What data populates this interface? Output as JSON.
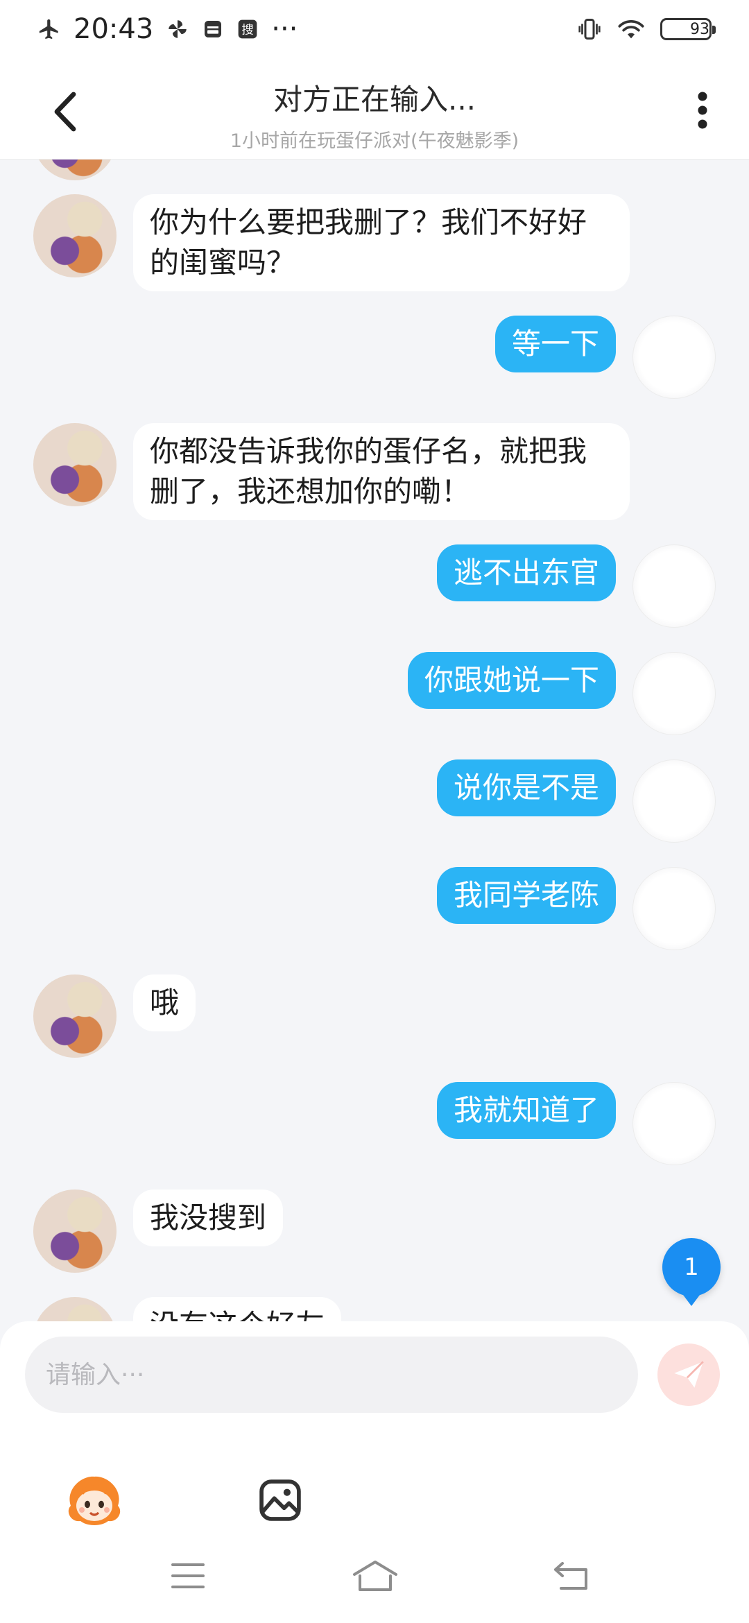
{
  "status_bar": {
    "time": "20:43",
    "extra_indicator": "···",
    "battery": "93",
    "battery_level": 0.93,
    "icons": [
      "airplane-icon",
      "pinwheel-icon",
      "wallet-icon",
      "search-app-icon",
      "vibrate-icon",
      "wifi-icon",
      "battery-icon"
    ]
  },
  "header": {
    "title": "对方正在输入...",
    "subtitle": "1小时前在玩蛋仔派对(午夜魅影季)",
    "back_icon": "chevron-left-icon",
    "more_icon": "more-vertical-icon"
  },
  "messages": [
    {
      "from": "friend",
      "text": "你为什么要把我删了？我们不好好的闺蜜吗？"
    },
    {
      "from": "me",
      "text": "等一下"
    },
    {
      "from": "friend",
      "text": "你都没告诉我你的蛋仔名，就把我删了，我还想加你的嘞！"
    },
    {
      "from": "me",
      "text": "逃不出东官"
    },
    {
      "from": "me",
      "text": "你跟她说一下"
    },
    {
      "from": "me",
      "text": "说你是不是"
    },
    {
      "from": "me",
      "text": "我同学老陈"
    },
    {
      "from": "friend",
      "text": "哦"
    },
    {
      "from": "me",
      "text": "我就知道了"
    },
    {
      "from": "friend",
      "text": "我没搜到"
    },
    {
      "from": "friend",
      "text": "没有这个好友"
    }
  ],
  "unread_badge": "1",
  "composer": {
    "placeholder": "请输入···",
    "send_icon": "paper-plane-icon",
    "emoji_icon": "mascot-emoji-icon",
    "image_icon": "image-icon"
  },
  "nav_bar": {
    "icons": [
      "menu-icon",
      "home-icon",
      "back-icon"
    ]
  },
  "colors": {
    "accent": "#2bb4f5",
    "background": "#f4f5f8",
    "badge": "#1a8ef2",
    "send_disabled": "#fde0dd"
  }
}
